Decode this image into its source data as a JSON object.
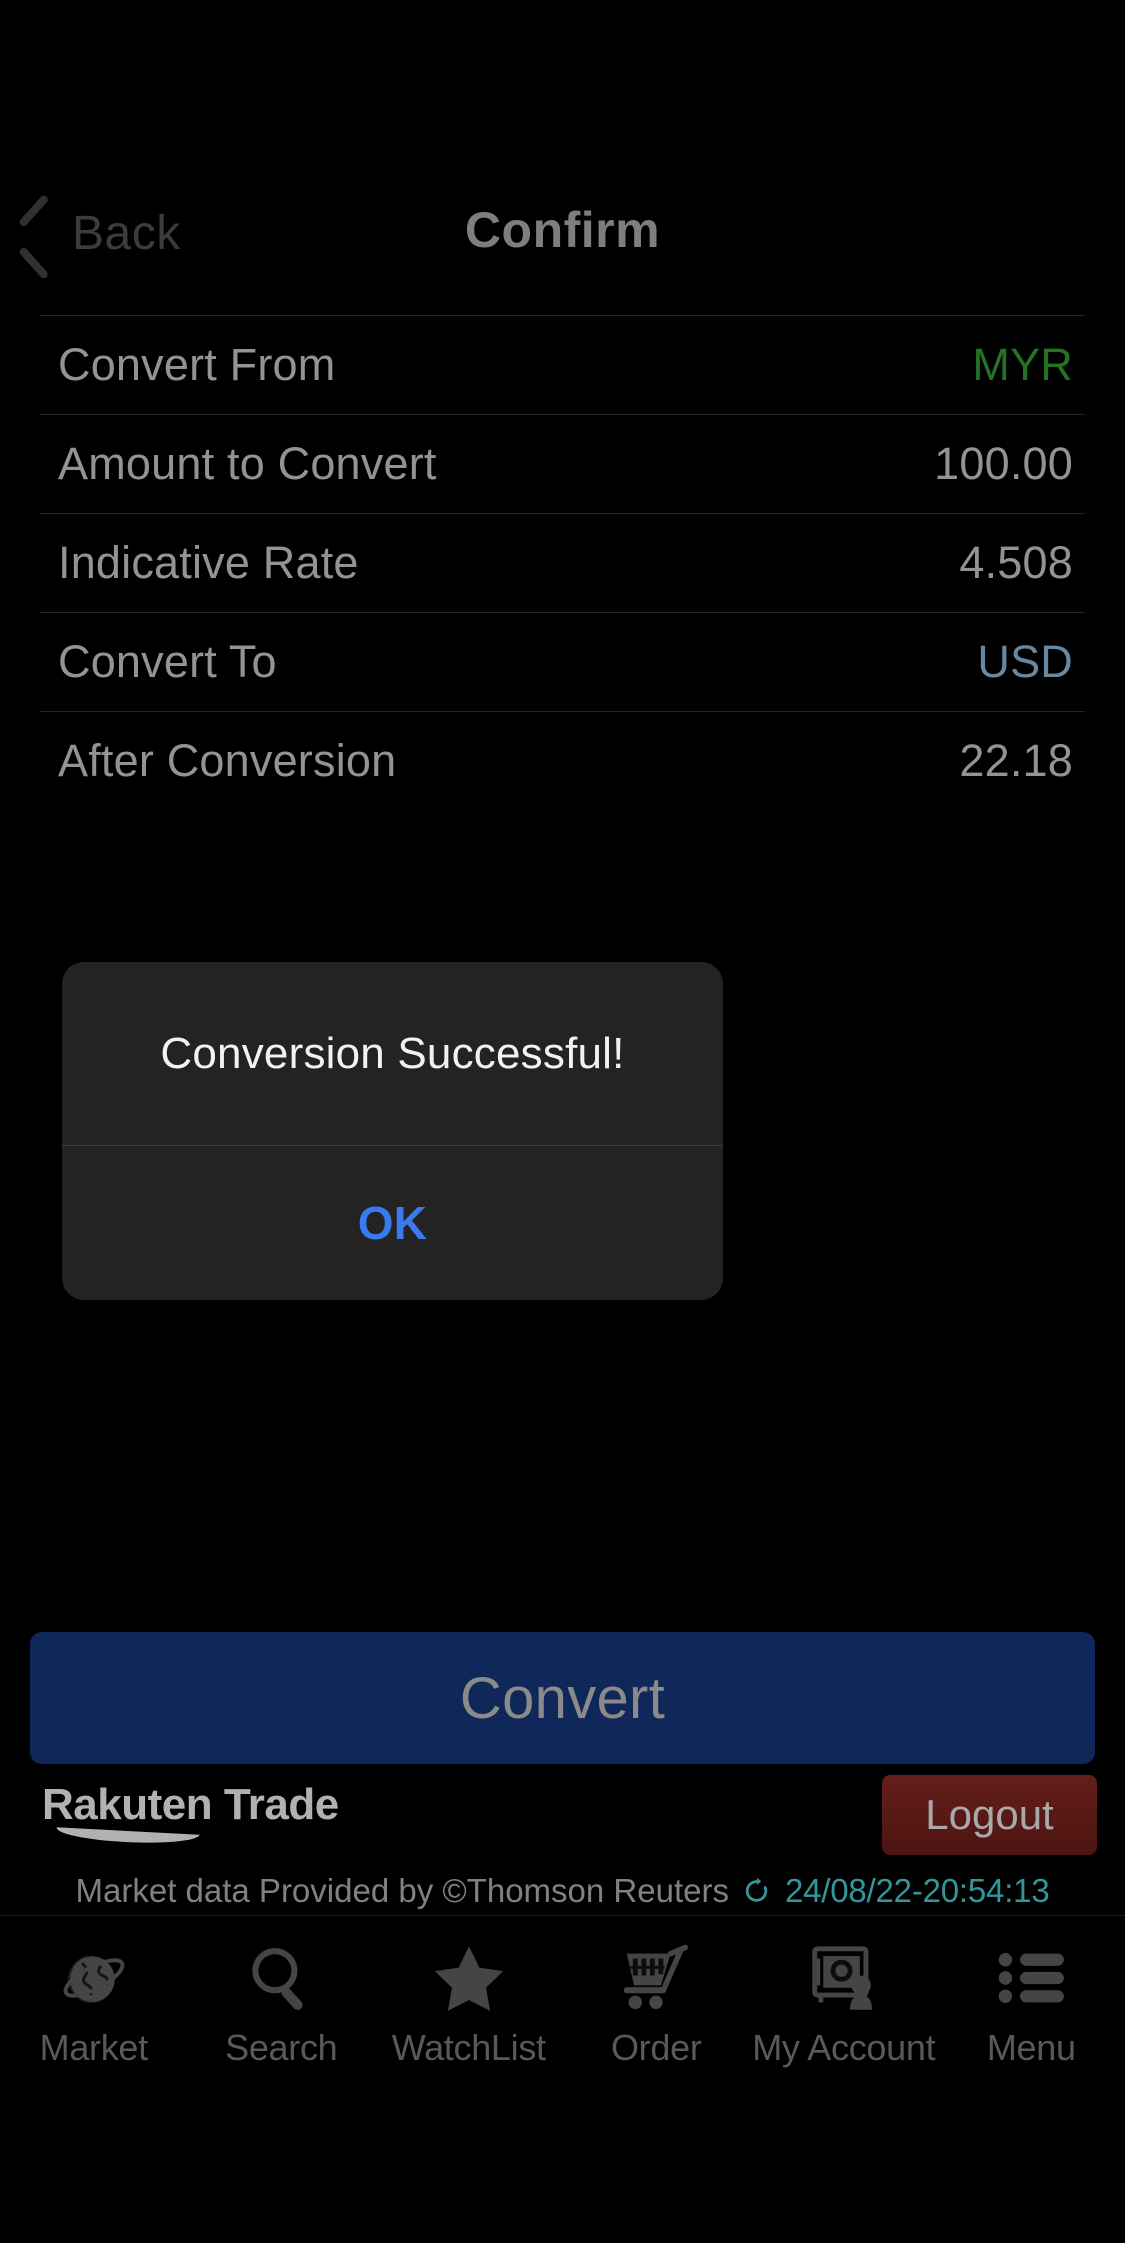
{
  "header": {
    "back_label": "Back",
    "title": "Confirm",
    "back_icon": "chevron-left-icon"
  },
  "details": {
    "rows": [
      {
        "label": "Convert From",
        "value": "MYR",
        "color_class": "green"
      },
      {
        "label": "Amount to Convert",
        "value": "100.00",
        "color_class": ""
      },
      {
        "label": "Indicative Rate",
        "value": "4.508",
        "color_class": ""
      },
      {
        "label": "Convert To",
        "value": "USD",
        "color_class": "blue"
      },
      {
        "label": "After Conversion",
        "value": "22.18",
        "color_class": ""
      }
    ]
  },
  "dialog": {
    "message": "Conversion Successful!",
    "ok_label": "OK",
    "accent_color": "#3b79f0"
  },
  "actions": {
    "convert_label": "Convert",
    "convert_color": "#13306d",
    "logout_label": "Logout",
    "logout_color": "#6b201c"
  },
  "footer": {
    "brand": "Rakuten Trade",
    "market_data_text": "Market data Provided by ©Thomson Reuters",
    "timestamp": "24/08/22-20:54:13",
    "timestamp_color": "#3fb8bd",
    "refresh_icon": "refresh-icon"
  },
  "tabbar": {
    "items": [
      {
        "label": "Market",
        "icon": "globe-icon"
      },
      {
        "label": "Search",
        "icon": "magnifier-icon"
      },
      {
        "label": "WatchList",
        "icon": "star-icon"
      },
      {
        "label": "Order",
        "icon": "cart-icon"
      },
      {
        "label": "My Account",
        "icon": "safe-icon"
      },
      {
        "label": "Menu",
        "icon": "list-icon"
      }
    ]
  }
}
